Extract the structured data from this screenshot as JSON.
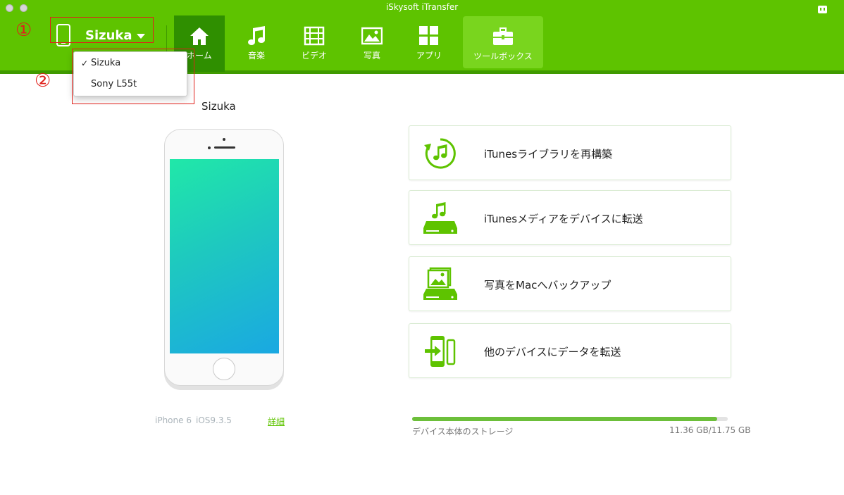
{
  "window": {
    "title": "iSkysoft iTransfer"
  },
  "device": {
    "name": "Sizuka"
  },
  "annotations": {
    "num1": "①",
    "num2": "②"
  },
  "dropdown": {
    "items": [
      {
        "label": "Sizuka",
        "checked": true,
        "check_glyph": "✓"
      },
      {
        "label": "Sony L55t",
        "checked": false
      }
    ]
  },
  "nav": {
    "tabs": [
      {
        "label": "ホーム",
        "icon": "home-icon",
        "active": true
      },
      {
        "label": "音楽",
        "icon": "music-icon"
      },
      {
        "label": "ビデオ",
        "icon": "video-icon"
      },
      {
        "label": "写真",
        "icon": "photo-icon"
      },
      {
        "label": "アプリ",
        "icon": "apps-icon"
      },
      {
        "label": "ツールボックス",
        "icon": "toolbox-icon"
      }
    ]
  },
  "main": {
    "device_name": "Sizuka",
    "model": "iPhone 6",
    "ios": "iOS9.3.5",
    "details_link": "詳細",
    "actions": [
      {
        "label": "iTunesライブラリを再構築",
        "icon": "rebuild-library-icon"
      },
      {
        "label": "iTunesメディアをデバイスに転送",
        "icon": "transfer-media-icon"
      },
      {
        "label": "写真をMacへバックアップ",
        "icon": "backup-photos-icon"
      },
      {
        "label": "他のデバイスにデータを転送",
        "icon": "phone-transfer-icon"
      }
    ],
    "storage": {
      "label": "デバイス本体のストレージ",
      "value": "11.36 GB/11.75 GB",
      "used_fraction": 0.967
    }
  },
  "colors": {
    "accent": "#5ec300",
    "accent_dark": "#2f8f00",
    "annotation": "#e0201a"
  }
}
